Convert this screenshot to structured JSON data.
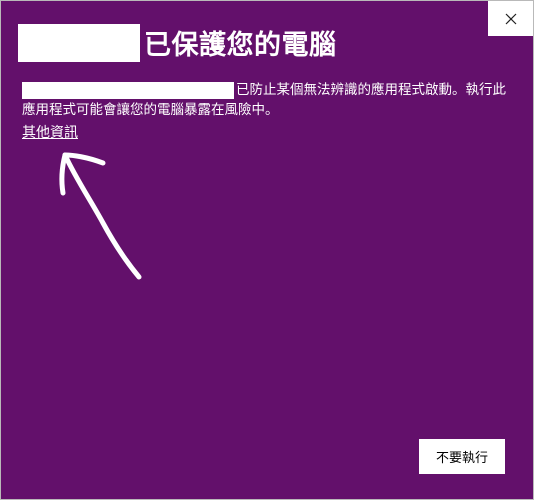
{
  "dialog": {
    "title": "已保護您的電腦",
    "message": "已防止某個無法辨識的應用程式啟動。執行此應用程式可能會讓您的電腦暴露在風險中。",
    "more_info_label": "其他資訊",
    "dont_run_label": "不要執行"
  },
  "colors": {
    "background": "#63106b",
    "foreground": "#ffffff",
    "button_bg": "#ffffff"
  },
  "icons": {
    "close": "close-icon"
  }
}
